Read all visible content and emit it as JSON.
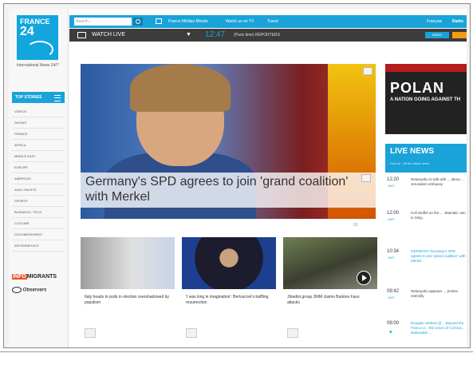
{
  "logo": {
    "line1": "FRANCE",
    "line2": "24",
    "tagline": "International News 24/7"
  },
  "sidebar": {
    "menu_label": "TOP STORIES",
    "items": [
      "VIDEOS",
      "SHOWS",
      "FRANCE",
      "AFRICA",
      "MIDDLE EAST",
      "EUROPE",
      "AMERICAS",
      "ASIA / PACIFIC",
      "SPORTS",
      "BUSINESS / TECH",
      "CULTURE",
      "DOCUMENTARIES",
      "INFOGRAPHICS"
    ],
    "info_prefix": "INFO",
    "info_suffix": "MIGRANTS",
    "observers": "Observers"
  },
  "topbar": {
    "search_placeholder": "Search...",
    "links": [
      "France Médias Monde",
      "Watch us on TV",
      "Travel"
    ],
    "lang": "Français",
    "lang2": "Radio"
  },
  "livebar": {
    "label": "WATCH LIVE",
    "chevron": "▼",
    "time": "12:47",
    "program": "(Paris time) REPORTERS",
    "news_btn": "NEWS"
  },
  "hero": {
    "headline": "Germany's SPD agrees to join 'grand coalition' with Merkel"
  },
  "pager": "01",
  "cards": [
    {
      "title": "Italy heads to polls in election overshadowed by populism"
    },
    {
      "title": "'I was king in imagination': Berlusconi's baffling resurrection"
    },
    {
      "title": "Jihadist group JNIM claims Burkina Faso attacks"
    }
  ],
  "promo": {
    "big": "POLAN",
    "small": "A NATION GOING AGAINST TH"
  },
  "live_news": {
    "title": "LIVE NEWS",
    "subtitle": "Sort by... All the latest news",
    "entries": [
      {
        "time": "12:20",
        "date": "GMT",
        "text": "Netanyahu to talk with ... about ... Jerusalem embassy",
        "blue": false
      },
      {
        "time": "12:00",
        "date": "GMT",
        "text": "Kofi Stoffel on the ... 'dramatic' win in Sing...",
        "blue": false
      },
      {
        "time": "10:34",
        "date": "GMT",
        "text": "GERMANY Germany's SPD agrees to join 'grand coalition' with Merkel",
        "blue": true
      },
      {
        "time": "09:42",
        "date": "GMT",
        "text": "Netanyahu appears ... probes intensify",
        "blue": false
      },
      {
        "time": "09:00",
        "date": "GMT",
        "text": "Douglas Herbert @... Beyond the France 2... the Union of Corsica... Nationalist ...",
        "blue": true
      }
    ]
  }
}
